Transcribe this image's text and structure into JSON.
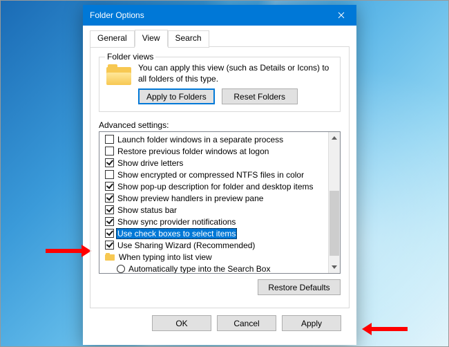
{
  "window": {
    "title": "Folder Options"
  },
  "tabs": {
    "general": "General",
    "view": "View",
    "search": "Search",
    "active": "view"
  },
  "folderViews": {
    "legend": "Folder views",
    "text1": "You can apply this view (such as Details or Icons) to",
    "text2": "all folders of this type.",
    "apply": "Apply to Folders",
    "reset": "Reset Folders"
  },
  "advanced": {
    "label": "Advanced settings:",
    "items": [
      {
        "type": "check",
        "checked": false,
        "label": "Launch folder windows in a separate process"
      },
      {
        "type": "check",
        "checked": false,
        "label": "Restore previous folder windows at logon"
      },
      {
        "type": "check",
        "checked": true,
        "label": "Show drive letters"
      },
      {
        "type": "check",
        "checked": false,
        "label": "Show encrypted or compressed NTFS files in color"
      },
      {
        "type": "check",
        "checked": true,
        "label": "Show pop-up description for folder and desktop items"
      },
      {
        "type": "check",
        "checked": true,
        "label": "Show preview handlers in preview pane"
      },
      {
        "type": "check",
        "checked": true,
        "label": "Show status bar"
      },
      {
        "type": "check",
        "checked": true,
        "label": "Show sync provider notifications"
      },
      {
        "type": "check",
        "checked": true,
        "label": "Use check boxes to select items",
        "selected": true
      },
      {
        "type": "check",
        "checked": true,
        "label": "Use Sharing Wizard (Recommended)"
      },
      {
        "type": "folder",
        "label": "When typing into list view"
      },
      {
        "type": "radio",
        "checked": false,
        "label": "Automatically type into the Search Box",
        "indent": 1
      }
    ],
    "restore": "Restore Defaults"
  },
  "buttons": {
    "ok": "OK",
    "cancel": "Cancel",
    "apply": "Apply"
  }
}
